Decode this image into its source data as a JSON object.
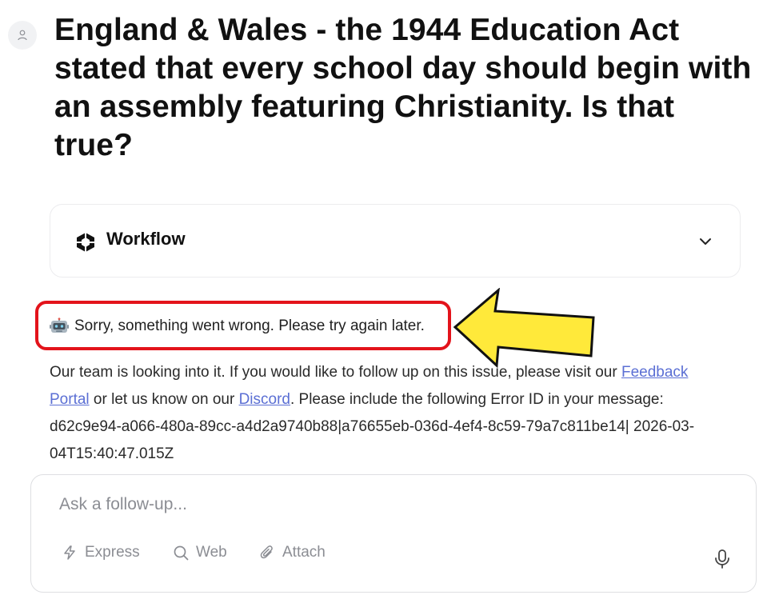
{
  "question": {
    "text": "England & Wales - the 1944 Education Act stated that every school day should begin with an assembly featuring Christianity.  Is that true?"
  },
  "avatar": {
    "icon": "user-icon"
  },
  "workflow": {
    "label": "Workflow",
    "icon": "workflow-logo-icon",
    "toggle_icon": "chevron-down-icon"
  },
  "error": {
    "icon": "robot-icon",
    "message": "Sorry, something went wrong. Please try again later.",
    "highlight_color": "#e3131b",
    "arrow_color": "#ffe93a"
  },
  "details": {
    "text_before_feedback": "Our team is looking into it. If you would like to follow up on this issue, please visit our ",
    "feedback_link": "Feedback Portal",
    "text_between": " or let us know on our ",
    "discord_link": "Discord",
    "text_after_discord": ". Please include the following Error ID in your message: ",
    "error_id": "d62c9e94-a066-480a-89cc-a4d2a9740b88|a76655eb-036d-4ef4-8c59-79a7c811be14| 2026-03-04T15:40:47.015Z",
    "link_color": "#5b6fd4"
  },
  "composer": {
    "placeholder": "Ask a follow-up...",
    "value": "",
    "tools": [
      {
        "label": "Express",
        "icon": "lightning-icon"
      },
      {
        "label": "Web",
        "icon": "search-icon"
      },
      {
        "label": "Attach",
        "icon": "paperclip-icon"
      }
    ],
    "mic_icon": "microphone-icon"
  }
}
